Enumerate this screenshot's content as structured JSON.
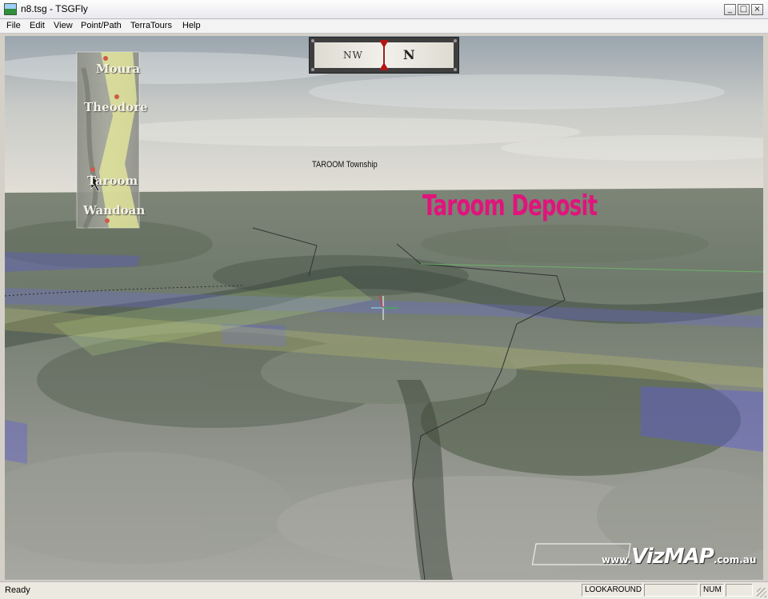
{
  "window": {
    "title": "n8.tsg - TSGFly",
    "controls": {
      "minimize": "_",
      "maximize": "□",
      "close": "×"
    }
  },
  "menu": {
    "items": [
      {
        "key": "file",
        "label": "File"
      },
      {
        "key": "edit",
        "label": "Edit"
      },
      {
        "key": "view",
        "label": "View"
      },
      {
        "key": "point_path",
        "label": "Point/Path"
      },
      {
        "key": "terratours",
        "label": "TerraTours"
      },
      {
        "key": "help",
        "label": "Help"
      }
    ]
  },
  "compass": {
    "left_heading": "NW",
    "right_heading": "N"
  },
  "minimap": {
    "towns": [
      "Moura",
      "Theodore",
      "Taroom",
      "Wandoan"
    ],
    "colors": {
      "corridor": "#e8ec9a",
      "dot": "#d05a4a"
    }
  },
  "scene": {
    "township_label": "TAROOM Township",
    "deposit_label": "Taroom Deposit",
    "colors": {
      "deposit_label": "#e0147c",
      "sky_top": "#a7b0b8",
      "sky_horizon": "#dcdad2"
    }
  },
  "watermark": {
    "main": "VizMAP",
    "prefix": "www.",
    "suffix": ".com.au"
  },
  "status": {
    "text": "Ready",
    "mode": "LOOKAROUND",
    "num": "NUM"
  }
}
